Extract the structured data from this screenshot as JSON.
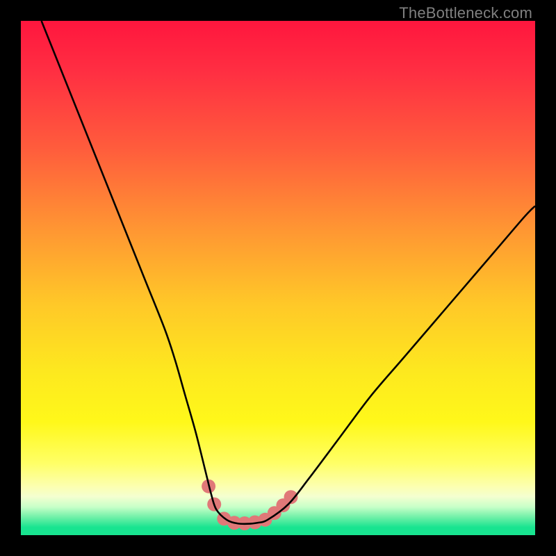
{
  "watermark": "TheBottleneck.com",
  "gradient": {
    "stops": [
      {
        "offset": 0.0,
        "color": "#ff163e"
      },
      {
        "offset": 0.1,
        "color": "#ff2f42"
      },
      {
        "offset": 0.25,
        "color": "#ff5d3c"
      },
      {
        "offset": 0.4,
        "color": "#ff9433"
      },
      {
        "offset": 0.55,
        "color": "#ffc828"
      },
      {
        "offset": 0.68,
        "color": "#fde81f"
      },
      {
        "offset": 0.78,
        "color": "#fff81a"
      },
      {
        "offset": 0.86,
        "color": "#ffff66"
      },
      {
        "offset": 0.905,
        "color": "#fcffb0"
      },
      {
        "offset": 0.925,
        "color": "#f4ffd0"
      },
      {
        "offset": 0.945,
        "color": "#c8ffc8"
      },
      {
        "offset": 0.965,
        "color": "#70f0a8"
      },
      {
        "offset": 0.985,
        "color": "#18e490"
      },
      {
        "offset": 1.0,
        "color": "#18e490"
      }
    ]
  },
  "chart_data": {
    "type": "line",
    "title": "",
    "xlabel": "",
    "ylabel": "",
    "x_range": [
      0,
      100
    ],
    "y_range": [
      0,
      100
    ],
    "series": [
      {
        "name": "bottleneck-curve",
        "color": "#000000",
        "x": [
          4,
          8,
          12,
          16,
          20,
          24,
          28,
          30,
          32,
          34,
          36,
          37,
          38,
          40,
          42,
          44,
          46,
          48,
          52,
          56,
          62,
          68,
          74,
          80,
          86,
          92,
          98,
          100
        ],
        "y": [
          100,
          90,
          80,
          70,
          60,
          50,
          40,
          34,
          27,
          20,
          12,
          8,
          5,
          3,
          2.3,
          2.2,
          2.4,
          3,
          6,
          11,
          19,
          27,
          34,
          41,
          48,
          55,
          62,
          64
        ]
      }
    ],
    "markers": {
      "name": "valley-dots",
      "color": "#e07878",
      "radius_pct": 1.35,
      "points": [
        {
          "x": 36.5,
          "y": 9.5
        },
        {
          "x": 37.6,
          "y": 6.0
        },
        {
          "x": 39.5,
          "y": 3.2
        },
        {
          "x": 41.5,
          "y": 2.4
        },
        {
          "x": 43.5,
          "y": 2.3
        },
        {
          "x": 45.5,
          "y": 2.5
        },
        {
          "x": 47.5,
          "y": 3.0
        },
        {
          "x": 49.3,
          "y": 4.3
        },
        {
          "x": 51.0,
          "y": 5.8
        },
        {
          "x": 52.5,
          "y": 7.4
        }
      ]
    }
  }
}
